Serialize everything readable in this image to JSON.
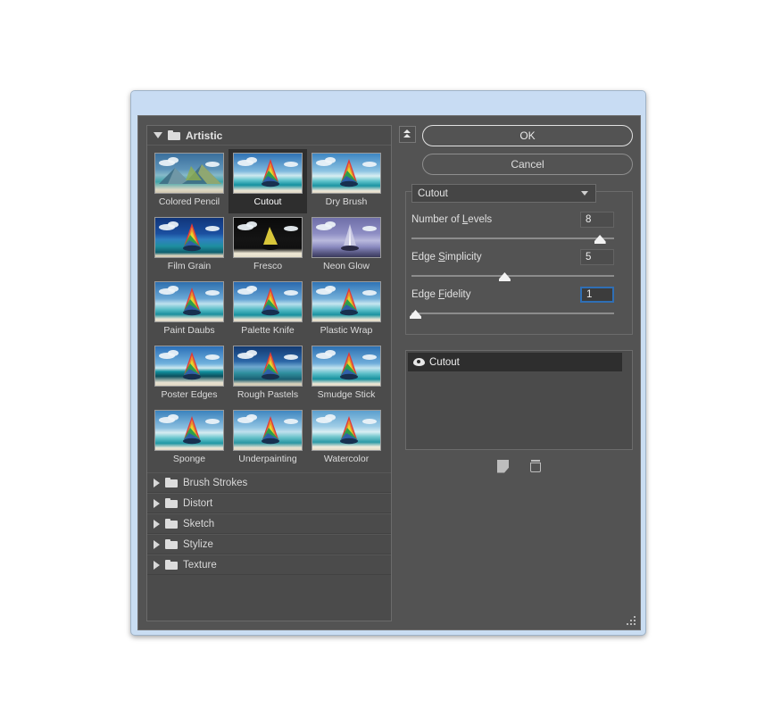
{
  "window": {
    "theme_accent": "#c8dcf3",
    "dialog_bg": "#535353",
    "panel_bg": "#4b4b4b",
    "selection_bg": "#2e2e2e",
    "focus_border": "#2f6fb5"
  },
  "browser": {
    "categories_expanded": [
      {
        "name": "Artistic",
        "icon": "folder-icon",
        "twisty": "triangle-down-icon",
        "expanded": true
      }
    ],
    "filters": [
      {
        "label": "Colored Pencil",
        "selected": false
      },
      {
        "label": "Cutout",
        "selected": true
      },
      {
        "label": "Dry Brush",
        "selected": false
      },
      {
        "label": "Film Grain",
        "selected": false
      },
      {
        "label": "Fresco",
        "selected": false
      },
      {
        "label": "Neon Glow",
        "selected": false
      },
      {
        "label": "Paint Daubs",
        "selected": false
      },
      {
        "label": "Palette Knife",
        "selected": false
      },
      {
        "label": "Plastic Wrap",
        "selected": false
      },
      {
        "label": "Poster Edges",
        "selected": false
      },
      {
        "label": "Rough Pastels",
        "selected": false
      },
      {
        "label": "Smudge Stick",
        "selected": false
      },
      {
        "label": "Sponge",
        "selected": false
      },
      {
        "label": "Underpainting",
        "selected": false
      },
      {
        "label": "Watercolor",
        "selected": false
      }
    ],
    "categories_collapsed": [
      {
        "label": "Brush Strokes"
      },
      {
        "label": "Distort"
      },
      {
        "label": "Sketch"
      },
      {
        "label": "Stylize"
      },
      {
        "label": "Texture"
      }
    ]
  },
  "controls": {
    "collapse_icon": "double-chevron-up-icon",
    "ok_label": "OK",
    "cancel_label": "Cancel",
    "filter_select": {
      "value": "Cutout",
      "caret_icon": "chevron-down-icon"
    },
    "parameters": [
      {
        "label_before": "Number of ",
        "label_mnemonic": "L",
        "label_after": "evels",
        "value": "8",
        "percent": 93,
        "focused": false
      },
      {
        "label_before": "Edge ",
        "label_mnemonic": "S",
        "label_after": "implicity",
        "value": "5",
        "percent": 46,
        "focused": false
      },
      {
        "label_before": "Edge ",
        "label_mnemonic": "F",
        "label_after": "idelity",
        "value": "1",
        "percent": 2,
        "focused": true
      }
    ]
  },
  "effect_layers": {
    "rows": [
      {
        "name": "Cutout",
        "visible": true,
        "visibility_icon": "eye-icon",
        "selected": true
      }
    ],
    "footer": {
      "new_effect_layer_icon": "new-effect-layer-icon",
      "delete_effect_layer_icon": "trash-icon"
    }
  }
}
